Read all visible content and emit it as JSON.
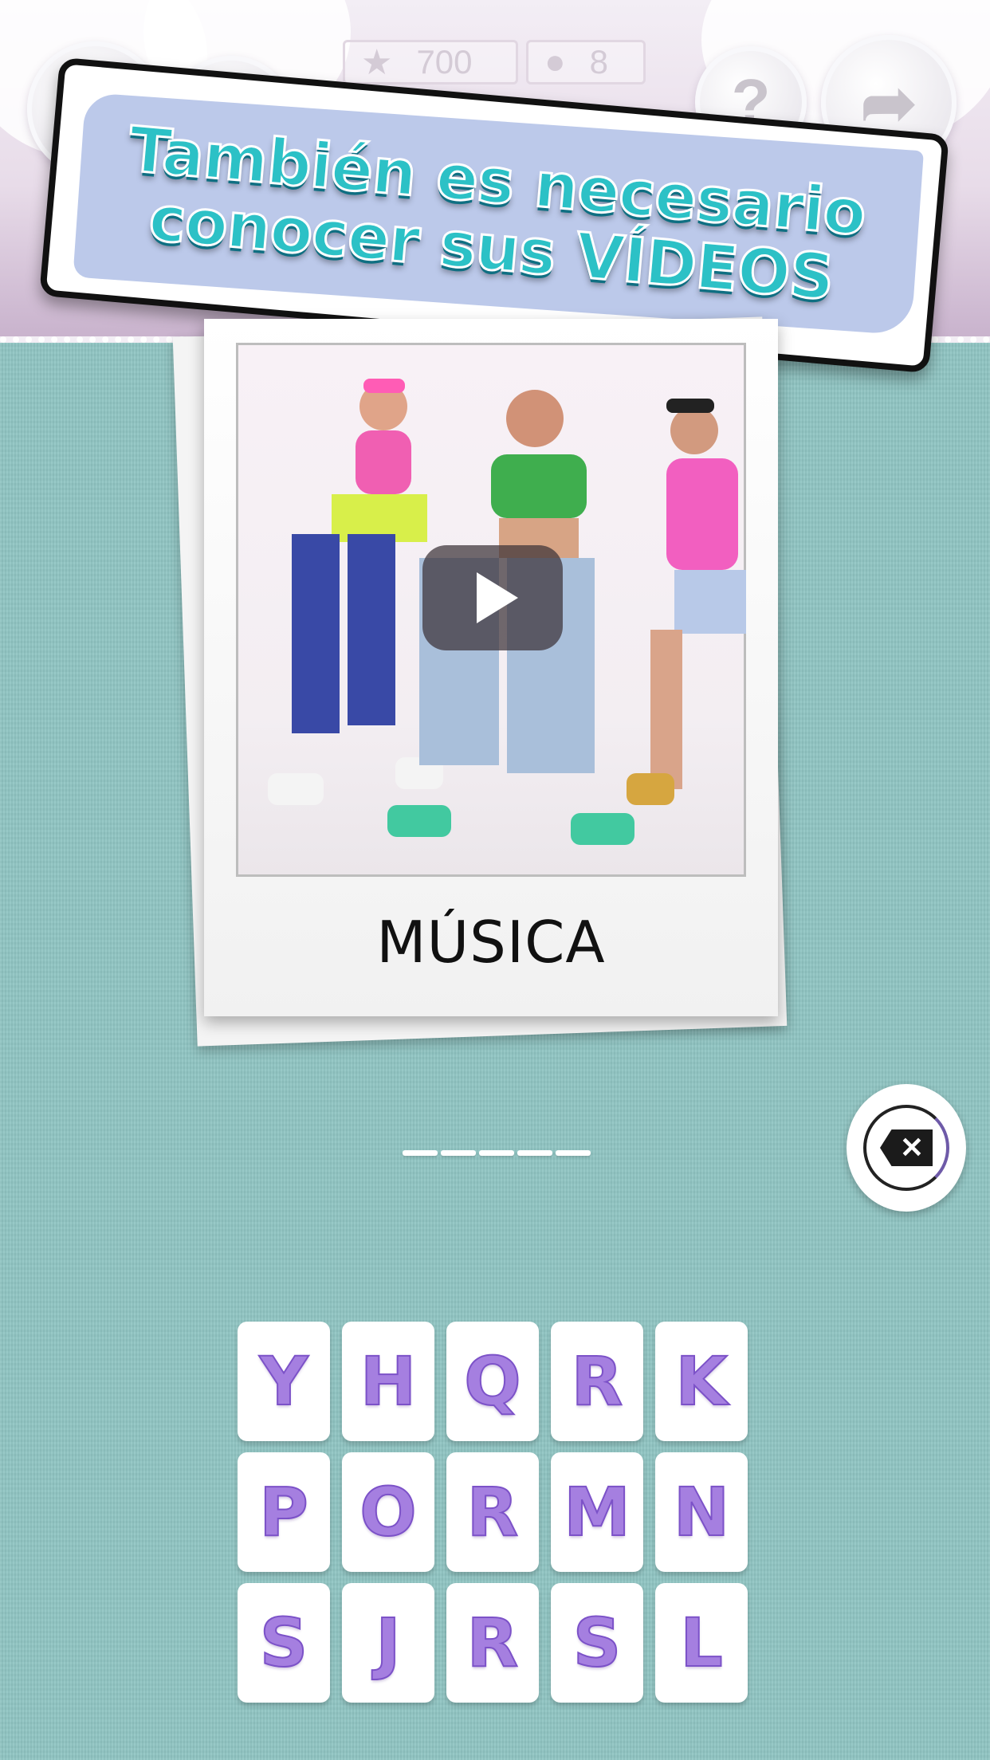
{
  "header": {
    "score": "700",
    "level": "8",
    "help_icon": "question-mark-icon",
    "share_icon": "share-arrow-icon"
  },
  "banner": {
    "line1": "También es necesario",
    "line2": "conocer sus VÍDEOS"
  },
  "card": {
    "category": "MÚSICA",
    "play_icon": "play-icon"
  },
  "answer": {
    "slot_count": 5
  },
  "letters": [
    "Y",
    "H",
    "Q",
    "R",
    "K",
    "P",
    "O",
    "R",
    "M",
    "N",
    "S",
    "J",
    "R",
    "S",
    "L"
  ],
  "colors": {
    "background": "#8fc4c2",
    "banner_text": "#2cc1c6",
    "letter_fill": "#a57fe0",
    "letter_stroke": "#7c52c8"
  }
}
